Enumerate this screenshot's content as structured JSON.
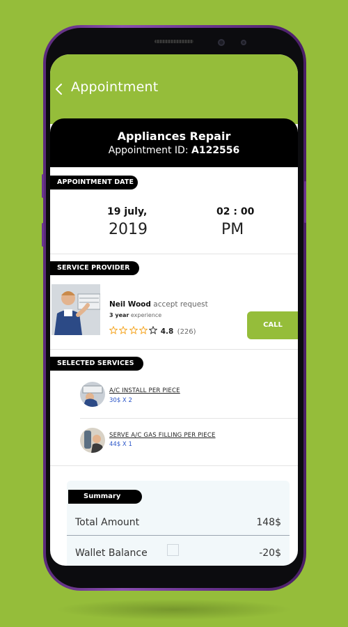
{
  "appbar": {
    "title": "Appointment",
    "back_icon": "chevron-left-icon"
  },
  "header": {
    "title": "Appliances Repair",
    "id_label": "Appointment ID:",
    "id_value": "A122556"
  },
  "appointment_date": {
    "section_label": "APPOINTMENT DATE",
    "date_top": "19 july,",
    "date_bottom": "2019",
    "time_top": "02 : 00",
    "time_bottom": "PM"
  },
  "service_provider": {
    "section_label": "SERVICE PROVIDER",
    "name": "Neil Wood",
    "status": "accept request",
    "experience_value": "3 year",
    "experience_label": "experience",
    "rating": "4.8",
    "rating_stars": 4,
    "reviews": "(226)",
    "call_label": "CALL"
  },
  "selected_services": {
    "section_label": "SELECTED SERVICES",
    "items": [
      {
        "name": "A/C INSTALL PER PIECE",
        "price": "30$ X 2"
      },
      {
        "name": "SERVE A/C GAS FILLING PER PIECE",
        "price": "44$ X 1"
      }
    ]
  },
  "summary": {
    "label": "Summary",
    "total_label": "Total Amount",
    "total_value": "148$",
    "wallet_label": "Wallet  Balance",
    "wallet_value": "-20$"
  },
  "colors": {
    "brand": "#95bd3a",
    "price": "#2a55c8",
    "star": "#f5a623"
  }
}
